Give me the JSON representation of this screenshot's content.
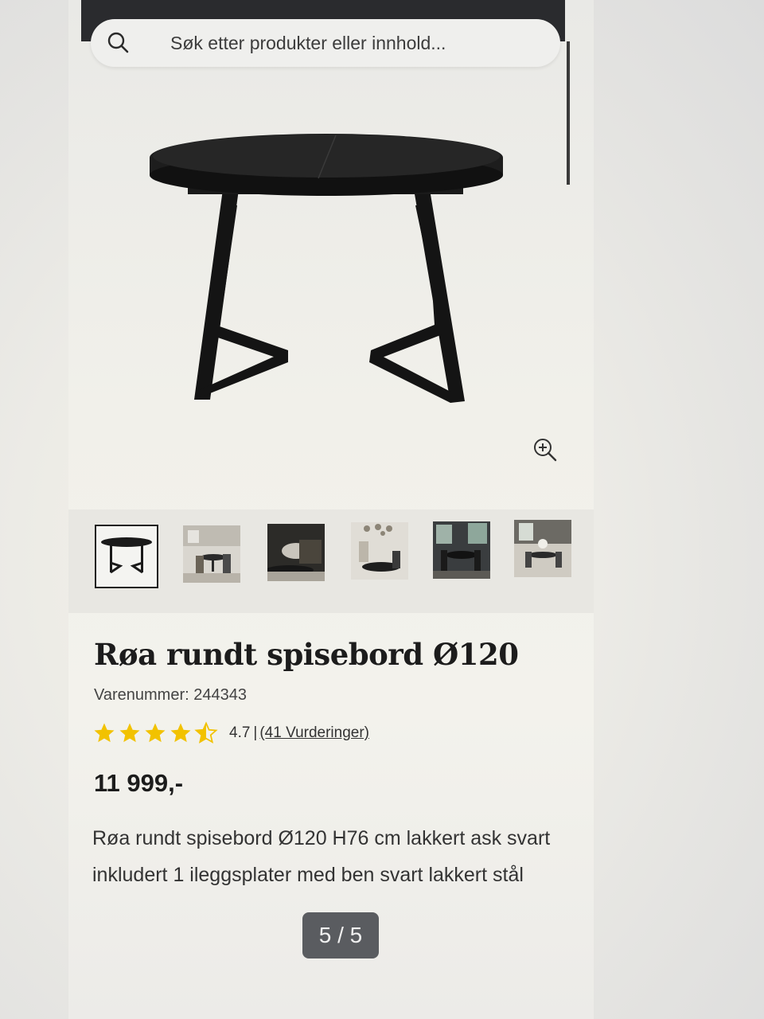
{
  "search": {
    "placeholder": "Søk etter produkter eller innhold..."
  },
  "gallery": {
    "thumbnails": [
      {
        "name": "table-product-photo"
      },
      {
        "name": "dining-room-photo"
      },
      {
        "name": "sofa-room-photo"
      },
      {
        "name": "pendant-lamp-room-photo"
      },
      {
        "name": "dark-dining-room-photo"
      },
      {
        "name": "bright-dining-room-photo"
      }
    ],
    "counter": "5 / 5"
  },
  "product": {
    "title": "Røa rundt spisebord Ø120",
    "sku": "Varenummer: 244343",
    "rating_value": "4.7",
    "rating": 4.7,
    "rating_separator": "|",
    "reviews_label": "(41 Vurderinger)",
    "price": "11 999,-",
    "description": "Røa rundt spisebord Ø120 H76 cm lakkert ask svart inkludert 1 ileggsplater med ben svart lakkert stål"
  },
  "colors": {
    "star": "#f2c200",
    "text": "#1f1f1f",
    "topbar": "#2a2b2e"
  }
}
